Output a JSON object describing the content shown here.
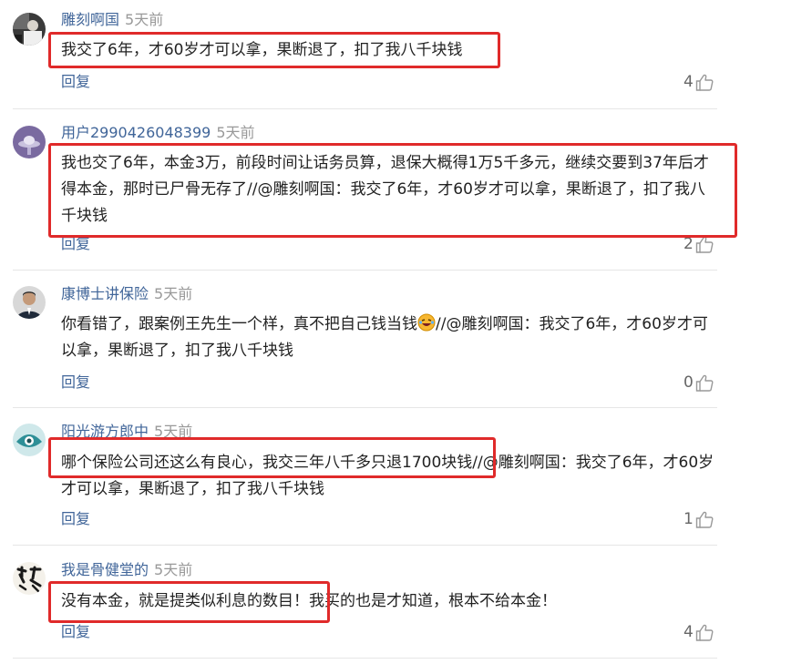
{
  "comments": [
    {
      "username": "雕刻啊国",
      "time": "5天前",
      "text": "我交了6年，才60岁才可以拿，果断退了，扣了我八千块钱",
      "reply_label": "回复",
      "likes": "4",
      "avatar": "dark-photo-avatar"
    },
    {
      "username": "用户2990426048399",
      "time": "5天前",
      "text": "我也交了6年，本金3万，前段时间让话务员算，退保大概得1万5千多元，继续交要到37年后才得本金，那时已尸骨无存了//@雕刻啊国：我交了6年，才60岁才可以拿，果断退了，扣了我八千块钱",
      "reply_label": "回复",
      "likes": "2",
      "avatar": "purple-ufo-avatar"
    },
    {
      "username": "康博士讲保险",
      "time": "5天前",
      "text_before_emoji": "你看错了，跟案例王先生一个样，真不把自己钱当钱",
      "text_after_emoji": "//@雕刻啊国：我交了6年，才60岁才可以拿，果断退了，扣了我八千块钱",
      "reply_label": "回复",
      "likes": "0",
      "avatar": "man-portrait-avatar"
    },
    {
      "username": "阳光游方郎中",
      "time": "5天前",
      "text": "哪个保险公司还这么有良心，我交三年八千多只退1700块钱//@雕刻啊国：我交了6年，才60岁才可以拿，果断退了，扣了我八千块钱",
      "reply_label": "回复",
      "likes": "1",
      "avatar": "teal-eye-avatar"
    },
    {
      "username": "我是骨健堂的",
      "time": "5天前",
      "text": "没有本金，就是提类似利息的数目！我买的也是才知道，根本不给本金！",
      "reply_label": "回复",
      "likes": "4",
      "avatar": "calligraphy-avatar"
    }
  ],
  "colors": {
    "username": "#406599",
    "time": "#999999",
    "text": "#222222",
    "highlight": "#e02a2a",
    "divider": "#e6e6e6"
  }
}
